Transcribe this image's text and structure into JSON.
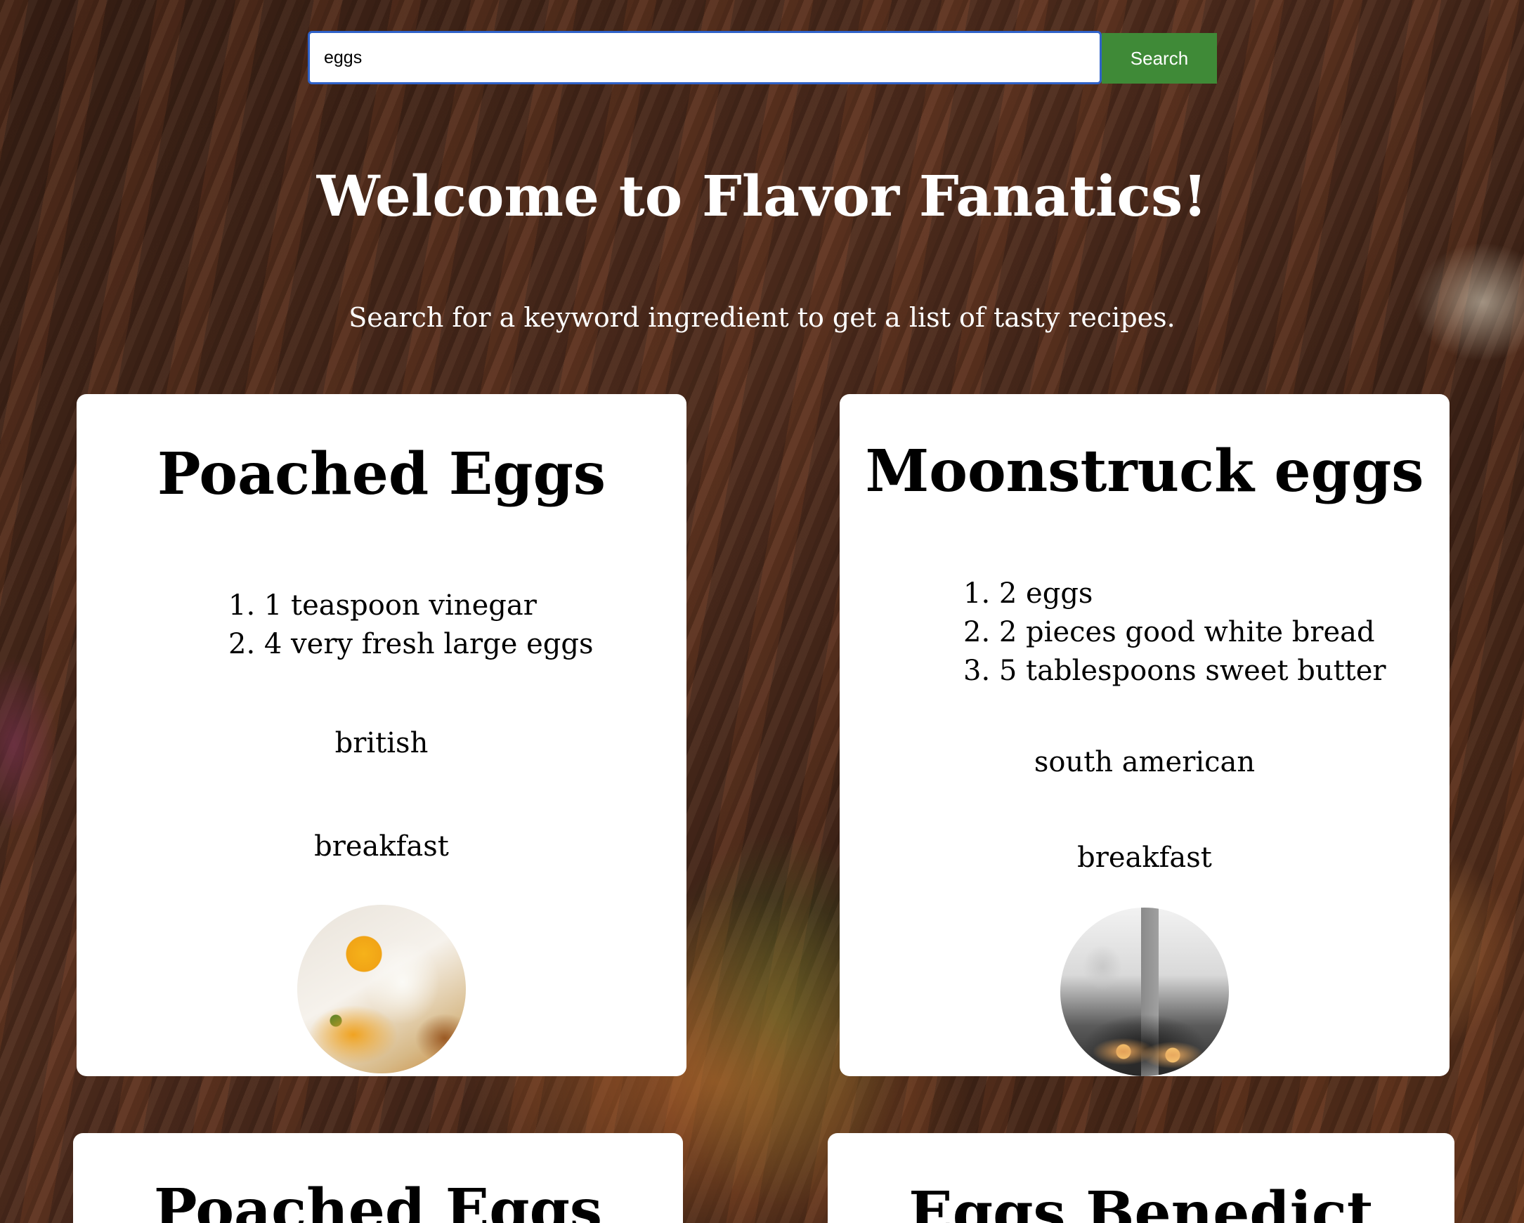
{
  "search": {
    "value": "eggs",
    "button_label": "Search"
  },
  "header": {
    "title": "Welcome to Flavor Fanatics!",
    "subtitle": "Search for a keyword ingredient to get a list of tasty recipes."
  },
  "recipes": [
    {
      "title": "Poached Eggs",
      "ingredients": [
        "1. 1 teaspoon vinegar",
        "2. 4 very fresh large eggs"
      ],
      "cuisine": "british",
      "meal_type": "breakfast",
      "image_icon": "poached-egg-photo"
    },
    {
      "title": "Moonstruck eggs",
      "ingredients": [
        "1. 2 eggs",
        "2. 2 pieces good white bread",
        "3. 5 tablespoons sweet butter"
      ],
      "cuisine": "south american",
      "meal_type": "breakfast",
      "image_icon": "moonstruck-eggs-photo"
    },
    {
      "title": "Poached Eggs"
    },
    {
      "title": "Eggs Benedict"
    }
  ],
  "colors": {
    "search_button": "#3f8a37",
    "search_focus_border": "#2f62c9",
    "card_background": "#ffffff",
    "heading_text": "#ffffff"
  }
}
